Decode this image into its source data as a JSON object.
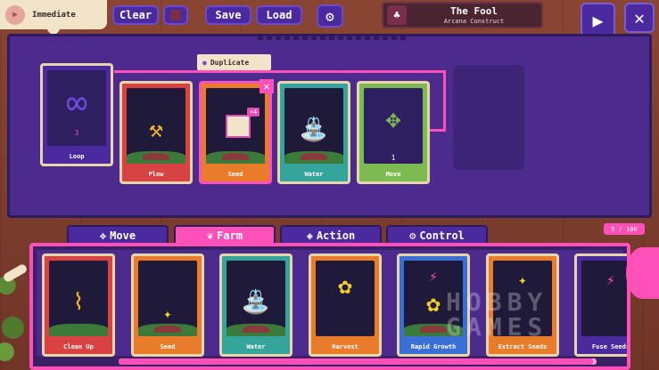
{
  "toolbar": {
    "speed_label": "Immediate",
    "clear_label": "Clear",
    "save_label": "Save",
    "load_label": "Load"
  },
  "character": {
    "name": "The Fool",
    "subtitle": "Arcana Construct"
  },
  "program": {
    "tooltip": "Duplicate",
    "seed_badge": "+4",
    "cards": [
      {
        "label": "Loop",
        "value": "3",
        "icon": "infinity-icon"
      },
      {
        "label": "Plow",
        "icon": "shovel-icon"
      },
      {
        "label": "Seed",
        "icon": "seed-bag-icon"
      },
      {
        "label": "Water",
        "icon": "watering-can-icon"
      },
      {
        "label": "Move",
        "value": "1",
        "icon": "arrows-icon"
      }
    ]
  },
  "palette": {
    "tabs": [
      {
        "label": "Move",
        "icon": "move-arrows-icon"
      },
      {
        "label": "Farm",
        "icon": "farm-icon"
      },
      {
        "label": "Action",
        "icon": "action-icon"
      },
      {
        "label": "Control",
        "icon": "gear-icon"
      }
    ],
    "counter": "5 / 100",
    "cards": [
      {
        "label": "Clean Up",
        "icon": "broom-icon"
      },
      {
        "label": "Seed",
        "icon": "sparkle-seeds-icon"
      },
      {
        "label": "Water",
        "icon": "watering-can-icon"
      },
      {
        "label": "Harvest",
        "icon": "sunflower-icon"
      },
      {
        "label": "Rapid Growth",
        "icon": "lightning-sunflower-icon"
      },
      {
        "label": "Extract Seeds",
        "icon": "sparkle-icon"
      },
      {
        "label": "Fuse Seeds",
        "icon": "lightning-icon"
      }
    ]
  },
  "watermark": "HOBBY GAMES",
  "colors": {
    "accent": "#ff4fb8",
    "board": "#4c2a8e",
    "button": "#4b2aa0"
  }
}
